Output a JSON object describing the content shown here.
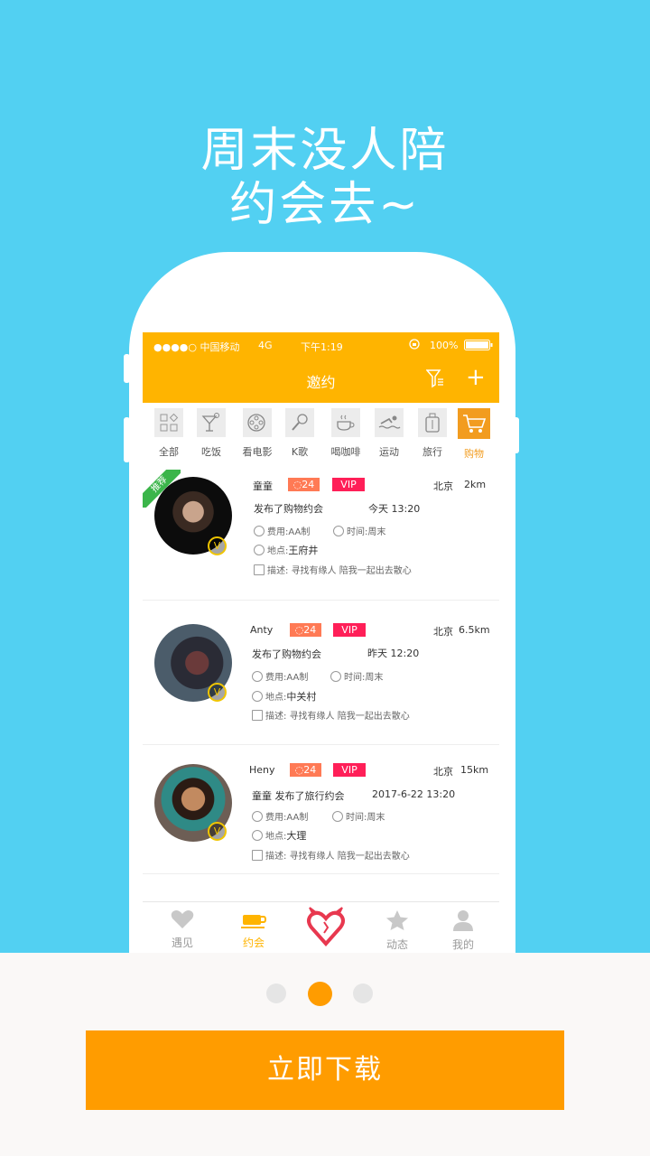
{
  "headline": {
    "line1": "周末没人陪",
    "line2": "约会去~"
  },
  "status_bar": {
    "carrier": "●●●●○ 中国移动",
    "network": "4G",
    "time": "下午1:19",
    "battery": "100%"
  },
  "nav": {
    "title": "邀约"
  },
  "categories": [
    {
      "label": "全部",
      "icon": "grid-icon"
    },
    {
      "label": "吃饭",
      "icon": "cocktail-icon"
    },
    {
      "label": "看电影",
      "icon": "film-reel-icon"
    },
    {
      "label": "K歌",
      "icon": "microphone-icon"
    },
    {
      "label": "喝咖啡",
      "icon": "coffee-icon"
    },
    {
      "label": "运动",
      "icon": "swimming-icon"
    },
    {
      "label": "旅行",
      "icon": "luggage-icon"
    },
    {
      "label": "购物",
      "icon": "cart-icon",
      "active": true
    }
  ],
  "posts": [
    {
      "recommended": "推荐",
      "name": "童童",
      "badge_count": "24",
      "vip": "VIP",
      "city": "北京",
      "distance": "2km",
      "action": "发布了购物约会",
      "time": "今天 13:20",
      "fee_label": "费用:",
      "fee": "AA制",
      "time_label": "时间:",
      "when": "周末",
      "place_label": "地点:",
      "place": "王府井",
      "desc_label": "描述:",
      "desc": "寻找有缘人 陪我一起出去散心"
    },
    {
      "name": "Anty",
      "badge_count": "24",
      "vip": "VIP",
      "city": "北京",
      "distance": "6.5km",
      "action": "发布了购物约会",
      "time": "昨天 12:20",
      "fee_label": "费用:",
      "fee": "AA制",
      "time_label": "时间:",
      "when": "周末",
      "place_label": "地点:",
      "place": "中关村",
      "desc_label": "描述:",
      "desc": "寻找有缘人 陪我一起出去散心"
    },
    {
      "name": "Heny",
      "badge_count": "24",
      "vip": "VIP",
      "city": "北京",
      "distance": "15km",
      "action": "童童 发布了旅行约会",
      "time": "2017-6-22 13:20",
      "fee_label": "费用:",
      "fee": "AA制",
      "time_label": "时间:",
      "when": "周末",
      "place_label": "地点:",
      "place": "大理",
      "desc_label": "描述:",
      "desc": "寻找有缘人 陪我一起出去散心"
    }
  ],
  "tabs": [
    {
      "label": "遇见",
      "icon": "heart-icon"
    },
    {
      "label": "约会",
      "icon": "coffee-cup-icon",
      "active": true
    },
    {
      "label": "",
      "icon": "devil-heart-logo-icon"
    },
    {
      "label": "动态",
      "icon": "star-icon"
    },
    {
      "label": "我的",
      "icon": "person-icon"
    }
  ],
  "pager": {
    "count": 3,
    "active": 2
  },
  "download_button": "立即下载",
  "colors": {
    "background": "#52d0f2",
    "accent": "#ffb400",
    "button": "#ff9c00",
    "vip": "#ff1f58",
    "badge": "#ff7a55"
  }
}
